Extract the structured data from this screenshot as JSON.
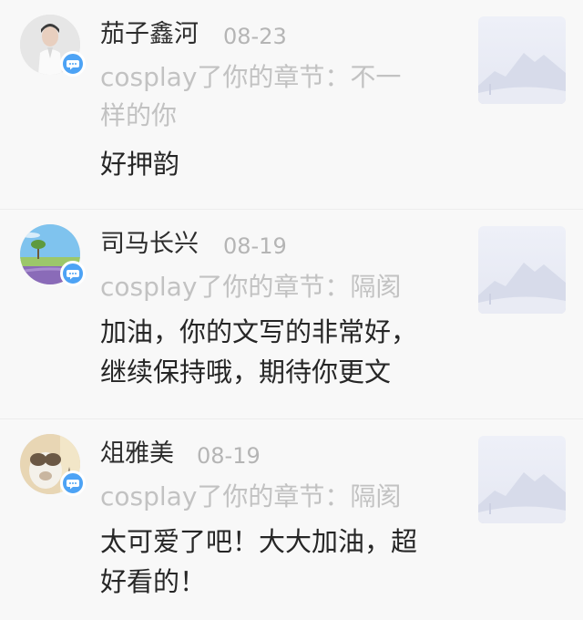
{
  "comments": [
    {
      "username": "茄子鑫河",
      "date": "08-23",
      "source_line1": "cosplay了你的章节：不一",
      "source_line2": "样的你",
      "text_line1": "好押韵",
      "text_line2": "",
      "avatar_icon": "avatar-person-photo",
      "badge_icon": "comment-bubble-icon",
      "thumb_icon": "mountain-placeholder-icon"
    },
    {
      "username": "司马长兴",
      "date": "08-19",
      "source_line1": "cosplay了你的章节：隔阂",
      "source_line2": "",
      "text_line1": "加油，你的文写的非常好，",
      "text_line2": "继续保持哦，期待你更文",
      "avatar_icon": "avatar-landscape-photo",
      "badge_icon": "comment-bubble-icon",
      "thumb_icon": "mountain-placeholder-icon"
    },
    {
      "username": "俎雅美",
      "date": "08-19",
      "source_line1": "cosplay了你的章节：隔阂",
      "source_line2": "",
      "text_line1": "太可爱了吧！大大加油，超",
      "text_line2": "好看的！",
      "avatar_icon": "avatar-animal-photo",
      "badge_icon": "comment-bubble-icon",
      "thumb_icon": "mountain-placeholder-icon"
    }
  ],
  "colors": {
    "background": "#f8f8f8",
    "username": "#2c2c2c",
    "date": "#b5b5b5",
    "source": "#c2c2c2",
    "text": "#262626",
    "badge": "#4da3f5"
  }
}
